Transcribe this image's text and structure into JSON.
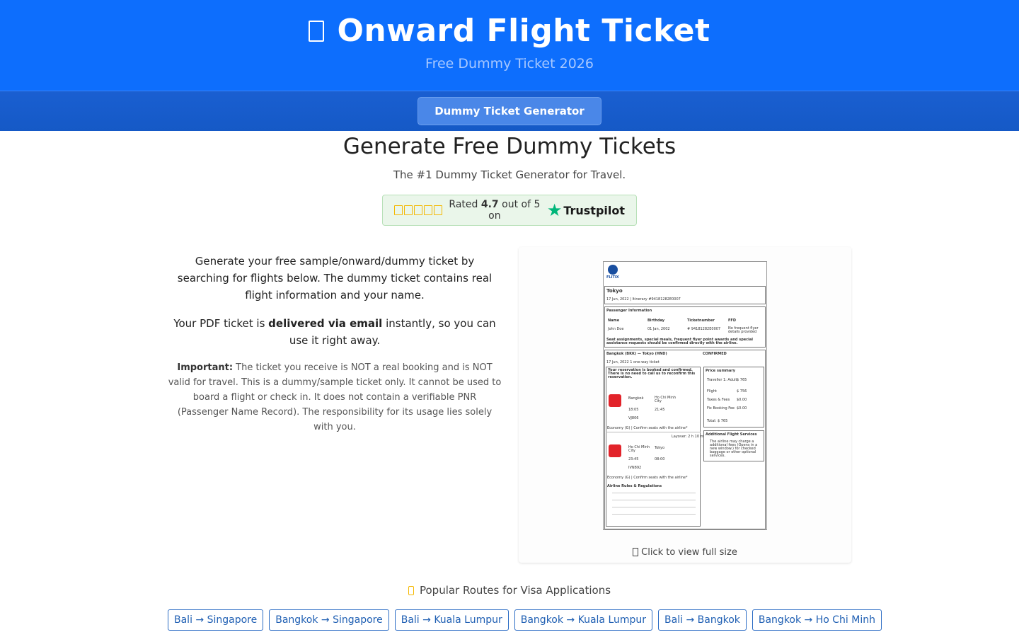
{
  "header": {
    "title": "Onward Flight Ticket",
    "subtitle": "Free Dummy Ticket 2026",
    "icon": "plane-icon"
  },
  "nav": {
    "button_label": "Dummy Ticket Generator"
  },
  "main": {
    "heading": "Generate Free Dummy Tickets",
    "tagline": "The #1 Dummy Ticket Generator for Travel.",
    "rating": {
      "prefix": "Rated",
      "score": "4.7",
      "suffix": "out of 5 on",
      "platform": "Trustpilot",
      "stars": 5
    }
  },
  "description": {
    "para1": "Generate your free sample/onward/dummy ticket by searching for flights below. The dummy ticket contains real flight information and your name.",
    "para2_before": "Your PDF ticket is ",
    "para2_bold": "delivered via email",
    "para2_after": " instantly, so you can use it right away.",
    "important_label": "Important:",
    "important_text": " The ticket you receive is NOT a real booking and is NOT valid for travel. This is a dummy/sample ticket only. It cannot be used to board a flight or check in. It does not contain a verifiable PNR (Passenger Name Record). The responsibility for its usage lies solely with you."
  },
  "preview": {
    "caption": "Click to view full size",
    "ticket": {
      "brand": "FLITIX",
      "destination": "Tokyo",
      "itinerary": "17 Jun, 2022  |  Itinerary #94181282E0007",
      "passenger_info": "Passenger Information",
      "col_name": "Name",
      "col_birthday": "Birthday",
      "col_ticket": "Ticketnumber",
      "col_ffd": "FFD",
      "passenger": "John Doe",
      "birthday": "01 Jan, 2002",
      "ticket_no": "# 94181282E0007",
      "ffd": "No frequent flyer details provided",
      "seat_note": "Seat assignments, special meals, frequent flyer point awards and special assistance requests should be confirmed directly with the airline.",
      "route": "Bangkok (BKK) — Tokyo (HND)",
      "status": "CONFIRMED",
      "trip_type": "17 Jun, 2022  1 one-way ticket",
      "reservation_note": "Your reservation is booked and confirmed. There is no need to call us to reconfirm this reservation.",
      "seg1_from": "Bangkok",
      "seg1_to": "Ho Chi Minh City",
      "seg1_dep": "18:05",
      "seg1_arr": "21:45",
      "seg1_flight": "VJ806",
      "economy1": "Economy (G) | Confirm seats with the airline*",
      "layover": "Layover: 2 h 10 m",
      "seg2_from": "Ho Chi Minh City",
      "seg2_to": "Tokyo",
      "seg2_dep": "23:45",
      "seg2_arr": "08:00",
      "seg2_flight": "IVN892",
      "economy2": "Economy (G) | Confirm seats with the airline*",
      "rules": "Airline Rules & Regulations",
      "price_summary": "Price summary",
      "traveller": "Traveller 1: Adult",
      "traveller_amt": "$ 765",
      "flight": "Flight",
      "flight_amt": "$ 756",
      "taxes": "Taxes & Fees",
      "taxes_amt": "$0.00",
      "fix_booking": "Fix Booking Fee",
      "fix_amt": "$0.00",
      "total": "Total: $ 765",
      "additional": "Additional Flight Services",
      "additional_note": "The airline may charge a additional fees (Opens in a new window.) for checked baggage or other optional services."
    }
  },
  "routes": {
    "title": "Popular Routes for Visa Applications",
    "items": [
      "Bali → Singapore",
      "Bangkok → Singapore",
      "Bali → Kuala Lumpur",
      "Bangkok → Kuala Lumpur",
      "Bali → Bangkok",
      "Bangkok → Ho Chi Minh"
    ]
  },
  "colors": {
    "header_bg": "#0d6efd",
    "nav_bg": "#1559c6",
    "trustpilot_green": "#00b67a",
    "star_gold": "#f5b800",
    "route_blue": "#2b6cc4"
  }
}
